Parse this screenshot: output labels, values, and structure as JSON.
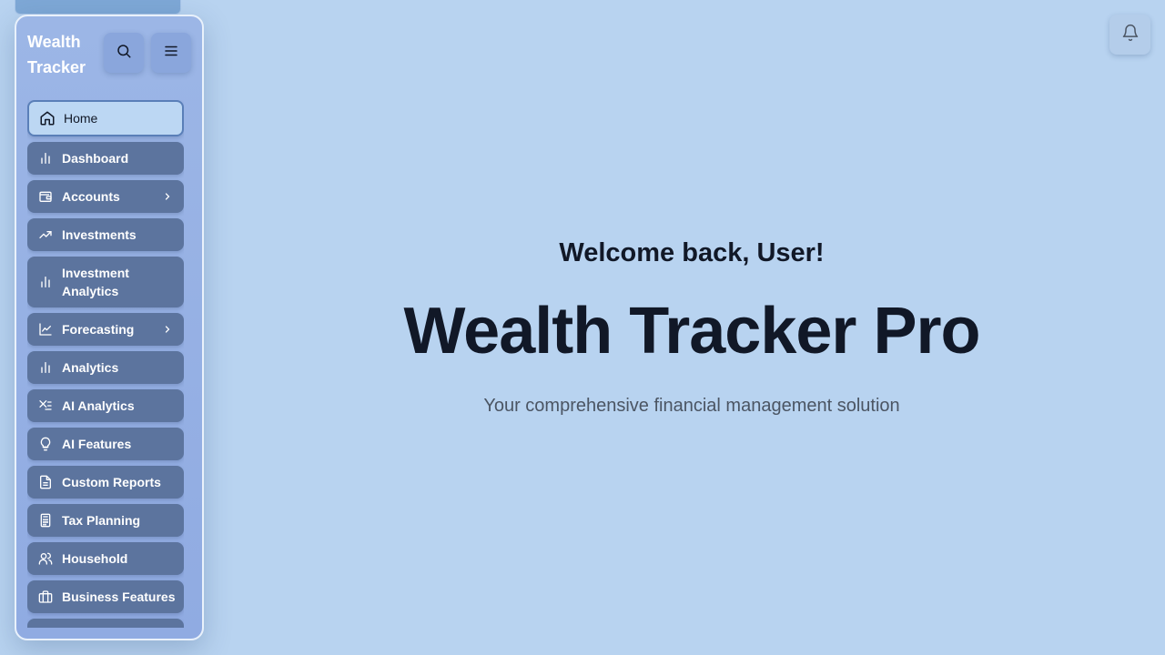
{
  "sidebar": {
    "brand": "Wealth Tracker",
    "search_icon": "search-icon",
    "menu_icon": "menu-icon",
    "items": [
      {
        "label": "Home",
        "icon": "home-icon",
        "active": true,
        "chevron": false
      },
      {
        "label": "Dashboard",
        "icon": "bar-chart-icon",
        "active": false,
        "chevron": false
      },
      {
        "label": "Accounts",
        "icon": "wallet-icon",
        "active": false,
        "chevron": true
      },
      {
        "label": "Investments",
        "icon": "trending-up-icon",
        "active": false,
        "chevron": false
      },
      {
        "label": "Investment Analytics",
        "icon": "bar-chart-icon",
        "active": false,
        "chevron": false
      },
      {
        "label": "Forecasting",
        "icon": "line-chart-icon",
        "active": false,
        "chevron": true
      },
      {
        "label": "Analytics",
        "icon": "bar-chart-icon",
        "active": false,
        "chevron": false
      },
      {
        "label": "AI Analytics",
        "icon": "sparkles-icon",
        "active": false,
        "chevron": false
      },
      {
        "label": "AI Features",
        "icon": "lightbulb-icon",
        "active": false,
        "chevron": false
      },
      {
        "label": "Custom Reports",
        "icon": "file-text-icon",
        "active": false,
        "chevron": false
      },
      {
        "label": "Tax Planning",
        "icon": "calculator-icon",
        "active": false,
        "chevron": false
      },
      {
        "label": "Household",
        "icon": "users-icon",
        "active": false,
        "chevron": false
      },
      {
        "label": "Business Features",
        "icon": "briefcase-icon",
        "active": false,
        "chevron": false
      }
    ]
  },
  "header": {
    "notification_icon": "bell-icon"
  },
  "main": {
    "welcome": "Welcome back, User!",
    "title": "Wealth Tracker Pro",
    "subtitle": "Your comprehensive financial management solution"
  },
  "colors": {
    "background": "#b8d3f0",
    "sidebar": "#95b0e4",
    "nav_item": "#5c749e",
    "nav_active": "#bcd7f3",
    "text_dark": "#111827",
    "text_muted": "#4b5563"
  }
}
